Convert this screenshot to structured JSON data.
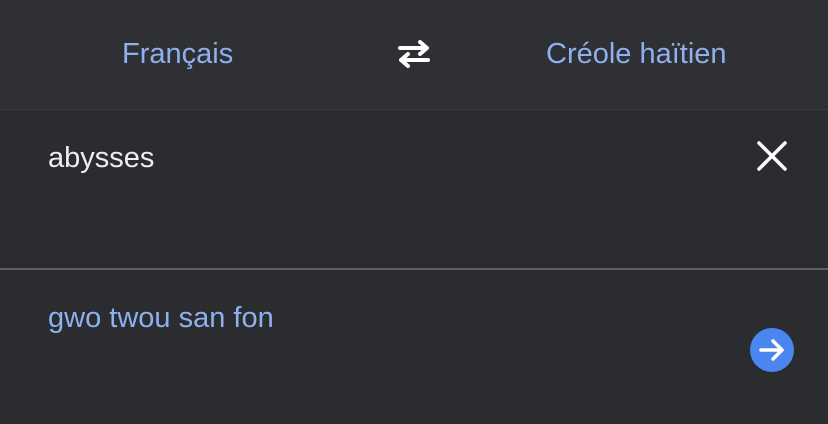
{
  "header": {
    "source_language": "Français",
    "target_language": "Créole haïtien",
    "swap_icon": "swap-arrows-icon"
  },
  "input": {
    "text": "abysses",
    "clear_icon": "close-icon"
  },
  "output": {
    "translation": "gwo twou san fon",
    "go_icon": "arrow-right-icon"
  },
  "colors": {
    "background": "#2b2c30",
    "accent_text": "#8fb0ee",
    "primary_text": "#eceef2",
    "button_blue": "#4a86f0",
    "divider": "#5e5f64"
  }
}
